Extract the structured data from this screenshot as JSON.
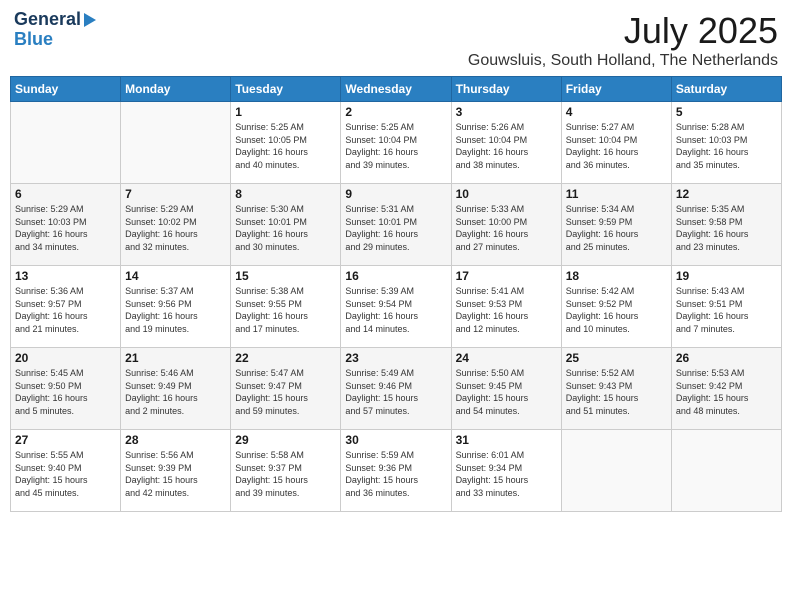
{
  "logo": {
    "line1": "General",
    "line2": "Blue"
  },
  "title": {
    "month": "July 2025",
    "location": "Gouwsluis, South Holland, The Netherlands"
  },
  "weekdays": [
    "Sunday",
    "Monday",
    "Tuesday",
    "Wednesday",
    "Thursday",
    "Friday",
    "Saturday"
  ],
  "weeks": [
    [
      {
        "day": "",
        "text": ""
      },
      {
        "day": "",
        "text": ""
      },
      {
        "day": "1",
        "text": "Sunrise: 5:25 AM\nSunset: 10:05 PM\nDaylight: 16 hours\nand 40 minutes."
      },
      {
        "day": "2",
        "text": "Sunrise: 5:25 AM\nSunset: 10:04 PM\nDaylight: 16 hours\nand 39 minutes."
      },
      {
        "day": "3",
        "text": "Sunrise: 5:26 AM\nSunset: 10:04 PM\nDaylight: 16 hours\nand 38 minutes."
      },
      {
        "day": "4",
        "text": "Sunrise: 5:27 AM\nSunset: 10:04 PM\nDaylight: 16 hours\nand 36 minutes."
      },
      {
        "day": "5",
        "text": "Sunrise: 5:28 AM\nSunset: 10:03 PM\nDaylight: 16 hours\nand 35 minutes."
      }
    ],
    [
      {
        "day": "6",
        "text": "Sunrise: 5:29 AM\nSunset: 10:03 PM\nDaylight: 16 hours\nand 34 minutes."
      },
      {
        "day": "7",
        "text": "Sunrise: 5:29 AM\nSunset: 10:02 PM\nDaylight: 16 hours\nand 32 minutes."
      },
      {
        "day": "8",
        "text": "Sunrise: 5:30 AM\nSunset: 10:01 PM\nDaylight: 16 hours\nand 30 minutes."
      },
      {
        "day": "9",
        "text": "Sunrise: 5:31 AM\nSunset: 10:01 PM\nDaylight: 16 hours\nand 29 minutes."
      },
      {
        "day": "10",
        "text": "Sunrise: 5:33 AM\nSunset: 10:00 PM\nDaylight: 16 hours\nand 27 minutes."
      },
      {
        "day": "11",
        "text": "Sunrise: 5:34 AM\nSunset: 9:59 PM\nDaylight: 16 hours\nand 25 minutes."
      },
      {
        "day": "12",
        "text": "Sunrise: 5:35 AM\nSunset: 9:58 PM\nDaylight: 16 hours\nand 23 minutes."
      }
    ],
    [
      {
        "day": "13",
        "text": "Sunrise: 5:36 AM\nSunset: 9:57 PM\nDaylight: 16 hours\nand 21 minutes."
      },
      {
        "day": "14",
        "text": "Sunrise: 5:37 AM\nSunset: 9:56 PM\nDaylight: 16 hours\nand 19 minutes."
      },
      {
        "day": "15",
        "text": "Sunrise: 5:38 AM\nSunset: 9:55 PM\nDaylight: 16 hours\nand 17 minutes."
      },
      {
        "day": "16",
        "text": "Sunrise: 5:39 AM\nSunset: 9:54 PM\nDaylight: 16 hours\nand 14 minutes."
      },
      {
        "day": "17",
        "text": "Sunrise: 5:41 AM\nSunset: 9:53 PM\nDaylight: 16 hours\nand 12 minutes."
      },
      {
        "day": "18",
        "text": "Sunrise: 5:42 AM\nSunset: 9:52 PM\nDaylight: 16 hours\nand 10 minutes."
      },
      {
        "day": "19",
        "text": "Sunrise: 5:43 AM\nSunset: 9:51 PM\nDaylight: 16 hours\nand 7 minutes."
      }
    ],
    [
      {
        "day": "20",
        "text": "Sunrise: 5:45 AM\nSunset: 9:50 PM\nDaylight: 16 hours\nand 5 minutes."
      },
      {
        "day": "21",
        "text": "Sunrise: 5:46 AM\nSunset: 9:49 PM\nDaylight: 16 hours\nand 2 minutes."
      },
      {
        "day": "22",
        "text": "Sunrise: 5:47 AM\nSunset: 9:47 PM\nDaylight: 15 hours\nand 59 minutes."
      },
      {
        "day": "23",
        "text": "Sunrise: 5:49 AM\nSunset: 9:46 PM\nDaylight: 15 hours\nand 57 minutes."
      },
      {
        "day": "24",
        "text": "Sunrise: 5:50 AM\nSunset: 9:45 PM\nDaylight: 15 hours\nand 54 minutes."
      },
      {
        "day": "25",
        "text": "Sunrise: 5:52 AM\nSunset: 9:43 PM\nDaylight: 15 hours\nand 51 minutes."
      },
      {
        "day": "26",
        "text": "Sunrise: 5:53 AM\nSunset: 9:42 PM\nDaylight: 15 hours\nand 48 minutes."
      }
    ],
    [
      {
        "day": "27",
        "text": "Sunrise: 5:55 AM\nSunset: 9:40 PM\nDaylight: 15 hours\nand 45 minutes."
      },
      {
        "day": "28",
        "text": "Sunrise: 5:56 AM\nSunset: 9:39 PM\nDaylight: 15 hours\nand 42 minutes."
      },
      {
        "day": "29",
        "text": "Sunrise: 5:58 AM\nSunset: 9:37 PM\nDaylight: 15 hours\nand 39 minutes."
      },
      {
        "day": "30",
        "text": "Sunrise: 5:59 AM\nSunset: 9:36 PM\nDaylight: 15 hours\nand 36 minutes."
      },
      {
        "day": "31",
        "text": "Sunrise: 6:01 AM\nSunset: 9:34 PM\nDaylight: 15 hours\nand 33 minutes."
      },
      {
        "day": "",
        "text": ""
      },
      {
        "day": "",
        "text": ""
      }
    ]
  ]
}
